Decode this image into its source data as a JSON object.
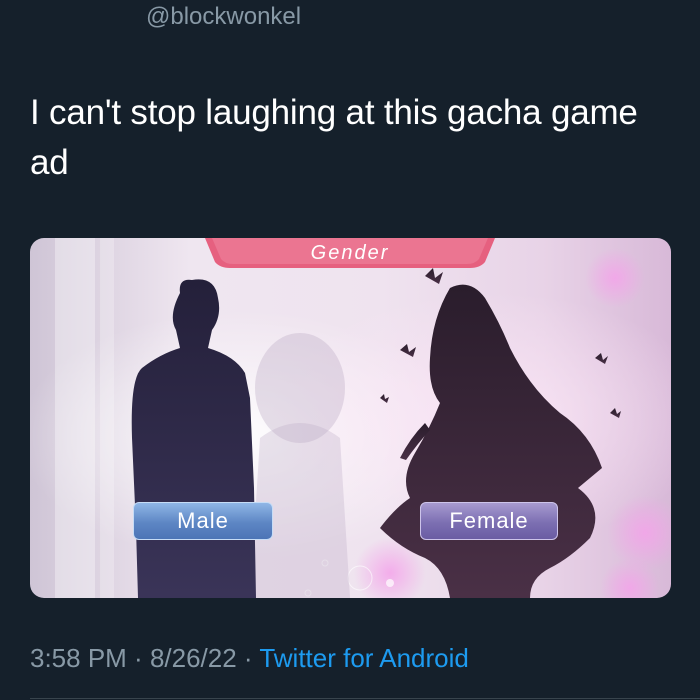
{
  "tweet": {
    "handle": "@blockwonkel",
    "text": "I can't stop laughing at this gacha game ad",
    "time": "3:58 PM",
    "separator1": " · ",
    "date": "8/26/22",
    "separator2": " · ",
    "source": "Twitter for Android"
  },
  "media": {
    "title": "Gender",
    "options": [
      {
        "label": "Male"
      },
      {
        "label": "Female"
      }
    ]
  },
  "colors": {
    "background": "#15202b",
    "muted": "#8899a6",
    "link": "#1d9bf0",
    "banner": "#e6607f"
  }
}
